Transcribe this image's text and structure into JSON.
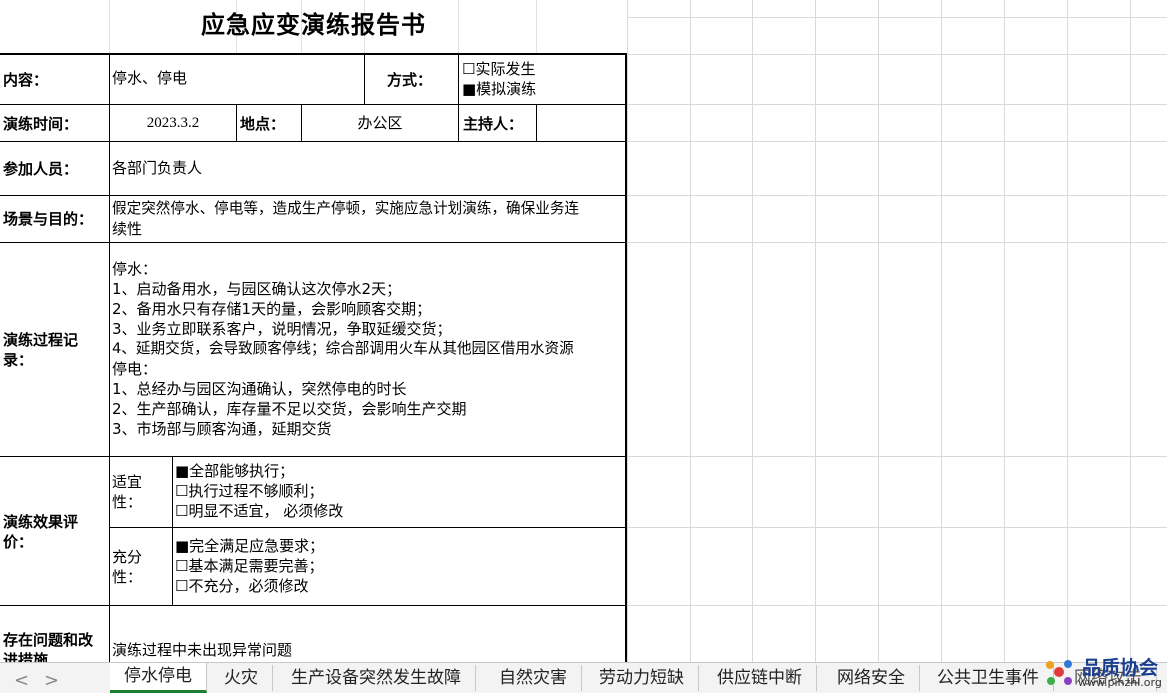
{
  "sheet": {
    "title": "应急应变演练报告书",
    "rows": {
      "content_label": "内容：",
      "content_value": "停水、停电",
      "mode_label": "方式：",
      "mode_opt1": "☐实际发生",
      "mode_opt2": "■模拟演练",
      "time_label": "演练时间：",
      "time_value": "2023.3.2",
      "place_label": "地点：",
      "place_value": "办公区",
      "host_label": "主持人：",
      "host_value": "",
      "people_label": "参加人员：",
      "people_value": "各部门负责人",
      "scene_label": "场景与目的：",
      "scene_line1": "假定突然停水、停电等，造成生产停顿，实施应急计划演练，确保业务连",
      "scene_line2": "续性",
      "process_label_1": "演练过程记",
      "process_label_2": "录：",
      "process_lines": [
        "停水：",
        "1、启动备用水，与园区确认这次停水2天；",
        "2、备用水只有存储1天的量，会影响顾客交期；",
        "3、业务立即联系客户，说明情况，争取延缓交货；",
        "4、延期交货，会导致顾客停线；综合部调用火车从其他园区借用水资源",
        "停电：",
        "1、总经办与园区沟通确认，突然停电的时长",
        "2、生产部确认，库存量不足以交货，会影响生产交期",
        "3、市场部与顾客沟通，延期交货"
      ],
      "effect_label_1": "演练效果评",
      "effect_label_2": "价：",
      "suit_label_1": "适宜",
      "suit_label_2": "性：",
      "suit_opts": [
        "■全部能够执行；",
        "☐执行过程不够顺利；",
        "☐明显不适宜，  必须修改"
      ],
      "full_label_1": "充分",
      "full_label_2": "性：",
      "full_opts": [
        "■完全满足应急要求；",
        "☐基本满足需要完善；",
        "☐不充分，必须修改"
      ],
      "issue_label_1": "存在问题和改",
      "issue_label_2": "进措施",
      "issue_value": "演练过程中未出现异常问题"
    }
  },
  "tabs": [
    "停水停电",
    "火灾",
    "生产设备突然发生故障",
    "自然灾害",
    "劳动力短缺",
    "供应链中断",
    "网络安全",
    "公共卫生事件",
    "网络攻击"
  ],
  "active_tab": 0,
  "nav": {
    "prev": "<",
    "next": ">"
  },
  "watermark": {
    "text": "品质协会",
    "url_text": "www.pinzhi.org"
  },
  "colors": {
    "grid": "#d9d9d9",
    "border": "#000000",
    "active_tab_line": "#1e7e34"
  }
}
